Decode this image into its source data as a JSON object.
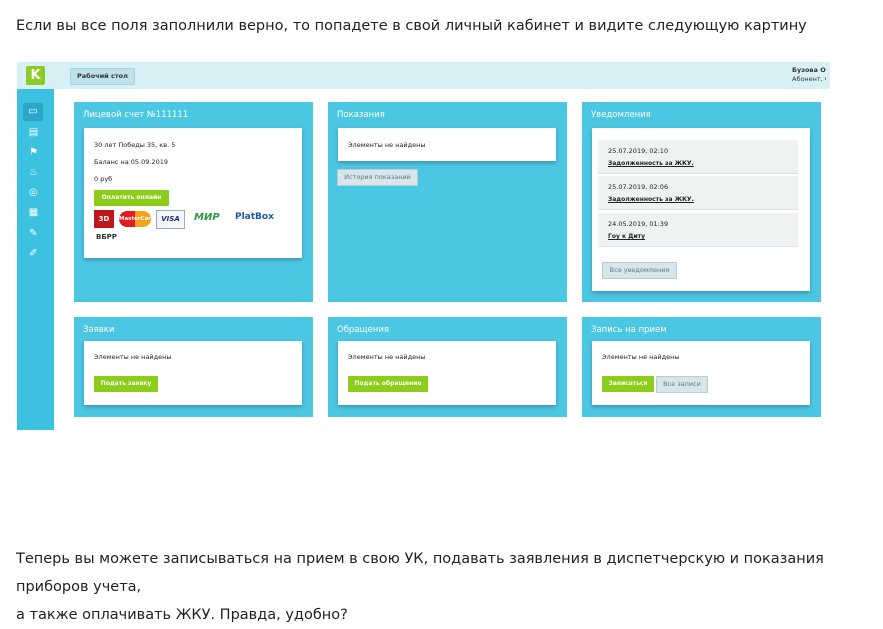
{
  "article": {
    "intro": "Если вы все поля заполнили верно, то попадете в свой личный кабинет и видите следующую картину",
    "outro_line1": "Теперь вы можете записываться на прием в свою УК, подавать заявления в диспетчерскую и показания приборов учета,",
    "outro_line2": "а также оплачивать ЖКУ. Правда, удобно?"
  },
  "app": {
    "logo": "K",
    "breadcrumb": "Рабочий стол",
    "user_name": "Бузова О",
    "user_role": "Абонент, С"
  },
  "sidebar": {
    "icons": [
      "desktop-icon",
      "receipt-icon",
      "flag-icon",
      "meter-icon",
      "coin-icon",
      "printer-icon",
      "edit-icon",
      "tag-icon"
    ],
    "glyphs": [
      "▭",
      "▤",
      "⚑",
      "♨",
      "◎",
      "▦",
      "✎",
      "✐"
    ]
  },
  "account": {
    "title": "Лицевой счет №111111",
    "address": "30 лет Победы 35, кв. 5",
    "balance_date": "Баланс на 05.09.2019",
    "balance_value": "0 руб",
    "pay_button": "Оплатить онлайн",
    "payment_logos": [
      "3D Secure",
      "MasterCard",
      "VISA",
      "МИР",
      "PlatBox",
      "ВБРР"
    ]
  },
  "readings": {
    "title": "Показания",
    "empty": "Элементы не найдены",
    "history_button": "История показаний"
  },
  "notifications": {
    "title": "Уведомления",
    "items": [
      {
        "date": "25.07.2019, 02:10",
        "text": "Задолженность за ЖКУ."
      },
      {
        "date": "25.07.2019, 02:06",
        "text": "Задолженность за ЖКУ."
      },
      {
        "date": "24.05.2019, 01:39",
        "text": "Гоу к Диту"
      }
    ],
    "all_button": "Все уведомления"
  },
  "requests": {
    "title": "Заявки",
    "empty": "Элементы не найдены",
    "button": "Подать заявку"
  },
  "appeals": {
    "title": "Обращения",
    "empty": "Элементы не найдены",
    "button": "Подать обращение"
  },
  "appointment": {
    "title": "Запись на прием",
    "empty": "Элементы не найдены",
    "signup_button": "Записаться",
    "all_button": "Все записи"
  },
  "colors": {
    "accent": "#4cc7e3",
    "sidebar": "#3dc1e0",
    "button_green": "#8ccc1a",
    "topbar": "#d6f0f5"
  }
}
